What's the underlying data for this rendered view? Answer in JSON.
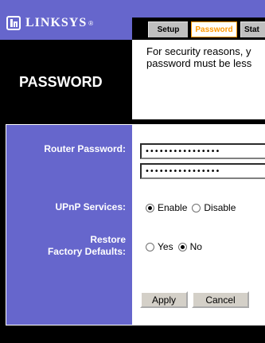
{
  "brand": {
    "name": "LINKSYS",
    "reg": "®"
  },
  "tabs": [
    {
      "label": "Setup",
      "active": false
    },
    {
      "label": "Password",
      "active": true
    },
    {
      "label": "Stat",
      "active": false
    }
  ],
  "section": {
    "title": "PASSWORD",
    "info_line1": "For security reasons, y",
    "info_line2": "password must be less"
  },
  "form": {
    "router_password_label": "Router Password:",
    "password_value": "••••••••••••••••",
    "password_confirm_value": "••••••••••••••••",
    "upnp_label": "UPnP Services:",
    "upnp_enable": "Enable",
    "upnp_disable": "Disable",
    "upnp_selected": "Enable",
    "restore_label_line1": "Restore",
    "restore_label_line2": "Factory Defaults:",
    "restore_yes": "Yes",
    "restore_no": "No",
    "restore_selected": "No"
  },
  "buttons": {
    "apply": "Apply",
    "cancel": "Cancel"
  },
  "colors": {
    "accent": "#6666cc",
    "active_tab": "#ff9900",
    "tab_bg": "#c0c0c0"
  }
}
